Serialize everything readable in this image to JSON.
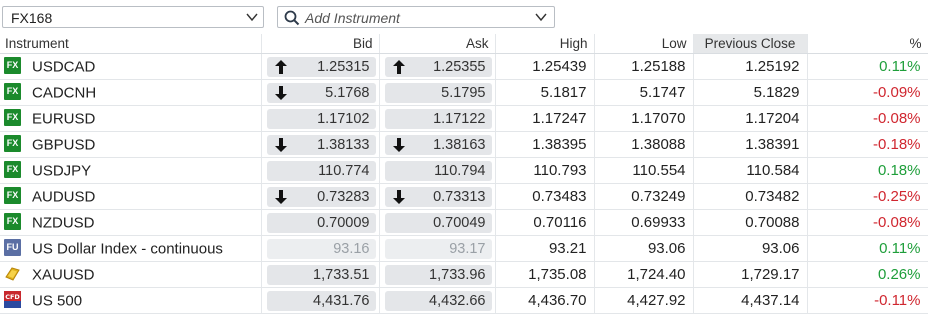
{
  "toolbar": {
    "list_value": "FX168",
    "search_placeholder": "Add Instrument"
  },
  "colors": {
    "positive": "#1e9e3a",
    "negative": "#d0262f",
    "fx_badge": "#1b8a2c"
  },
  "columns": {
    "instrument": "Instrument",
    "bid": "Bid",
    "ask": "Ask",
    "high": "High",
    "low": "Low",
    "prev_close": "Previous Close",
    "pct": "%"
  },
  "rows": [
    {
      "badge": "FX",
      "icon": "fx-badge-icon",
      "name": "USDCAD",
      "bid": "1.25315",
      "bid_arrow": "up",
      "ask": "1.25355",
      "ask_arrow": "up",
      "high": "1.25439",
      "low": "1.25188",
      "prev": "1.25192",
      "pct": "0.11%",
      "dir": "pos"
    },
    {
      "badge": "FX",
      "icon": "fx-badge-icon",
      "name": "CADCNH",
      "bid": "5.1768",
      "bid_arrow": "down",
      "ask": "5.1795",
      "ask_arrow": "",
      "high": "5.1817",
      "low": "5.1747",
      "prev": "5.1829",
      "pct": "-0.09%",
      "dir": "neg"
    },
    {
      "badge": "FX",
      "icon": "fx-badge-icon",
      "name": "EURUSD",
      "bid": "1.17102",
      "bid_arrow": "",
      "ask": "1.17122",
      "ask_arrow": "",
      "high": "1.17247",
      "low": "1.17070",
      "prev": "1.17204",
      "pct": "-0.08%",
      "dir": "neg"
    },
    {
      "badge": "FX",
      "icon": "fx-badge-icon",
      "name": "GBPUSD",
      "bid": "1.38133",
      "bid_arrow": "down",
      "ask": "1.38163",
      "ask_arrow": "down",
      "high": "1.38395",
      "low": "1.38088",
      "prev": "1.38391",
      "pct": "-0.18%",
      "dir": "neg"
    },
    {
      "badge": "FX",
      "icon": "fx-badge-icon",
      "name": "USDJPY",
      "bid": "110.774",
      "bid_arrow": "",
      "ask": "110.794",
      "ask_arrow": "",
      "high": "110.793",
      "low": "110.554",
      "prev": "110.584",
      "pct": "0.18%",
      "dir": "pos"
    },
    {
      "badge": "FX",
      "icon": "fx-badge-icon",
      "name": "AUDUSD",
      "bid": "0.73283",
      "bid_arrow": "down",
      "ask": "0.73313",
      "ask_arrow": "down",
      "high": "0.73483",
      "low": "0.73249",
      "prev": "0.73482",
      "pct": "-0.25%",
      "dir": "neg"
    },
    {
      "badge": "FX",
      "icon": "fx-badge-icon",
      "name": "NZDUSD",
      "bid": "0.70009",
      "bid_arrow": "",
      "ask": "0.70049",
      "ask_arrow": "",
      "high": "0.70116",
      "low": "0.69933",
      "prev": "0.70088",
      "pct": "-0.08%",
      "dir": "neg"
    },
    {
      "badge": "FU",
      "icon": "futures-badge-icon",
      "name": "US Dollar Index - continuous",
      "bid": "93.16",
      "bid_arrow": "",
      "ask": "93.17",
      "ask_arrow": "",
      "high": "93.21",
      "low": "93.06",
      "prev": "93.06",
      "pct": "0.11%",
      "dir": "pos",
      "dim": true
    },
    {
      "badge": "",
      "icon": "gold-bar-icon",
      "name": "XAUUSD",
      "bid": "1,733.51",
      "bid_arrow": "",
      "ask": "1,733.96",
      "ask_arrow": "",
      "high": "1,735.08",
      "low": "1,724.40",
      "prev": "1,729.17",
      "pct": "0.26%",
      "dir": "pos"
    },
    {
      "badge": "",
      "icon": "cfd-badge-icon",
      "name": "US 500",
      "bid": "4,431.76",
      "bid_arrow": "",
      "ask": "4,432.66",
      "ask_arrow": "",
      "high": "4,436.70",
      "low": "4,427.92",
      "prev": "4,437.14",
      "pct": "-0.11%",
      "dir": "neg"
    }
  ]
}
